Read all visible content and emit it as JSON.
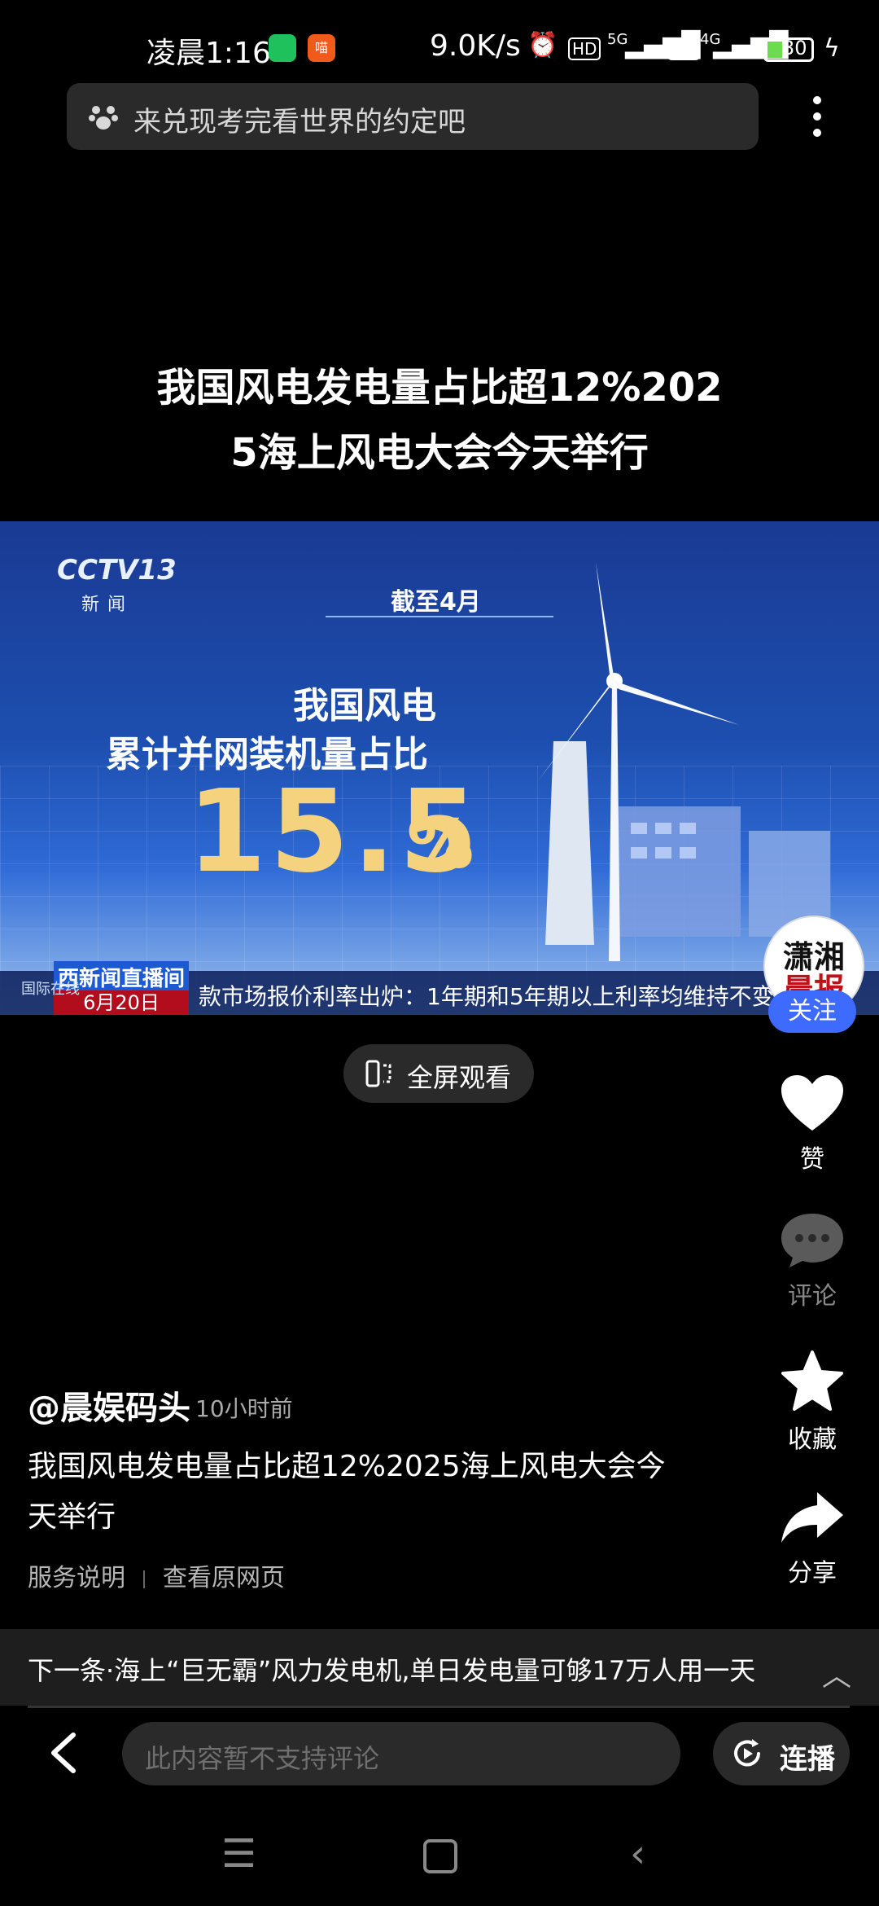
{
  "status_bar": {
    "time": "凌晨1:16",
    "net_speed": "9.0K/s",
    "signal1_label": "5G",
    "signal2_label": "4G",
    "hd_label": "HD",
    "battery": "30",
    "notification_badge": "喵",
    "wechat_icon": "wechat-icon",
    "alarm_icon": "alarm-icon"
  },
  "search": {
    "placeholder": "来兑现考完看世界的约定吧",
    "icon": "paw-icon"
  },
  "headline": {
    "line1": "我国风电发电量占比超12%202",
    "line2": "5海上风电大会今天举行"
  },
  "video": {
    "channel": "CCTV13",
    "channel_sub": "新闻",
    "caption": "截至4月",
    "text_line1": "我国风电",
    "text_line2": "累计并网装机量占比",
    "big_number": "15.5",
    "percent_sign": "%",
    "news_label": "西新闻直播间",
    "tiny_label": "国际在线",
    "date": "6月20日 11:01",
    "ticker": "款市场报价利率出炉：1年期和5年期以上利率均维持不变"
  },
  "avatar": {
    "line1": "潇湘",
    "line2": "晨报"
  },
  "follow_label": "关注",
  "fullscreen_label": "全屏观看",
  "actions": {
    "like": "赞",
    "comment": "评论",
    "favorite": "收藏",
    "share": "分享"
  },
  "post": {
    "author": "@晨娱码头",
    "age": "10小时前",
    "description": "我国风电发电量占比超12%2025海上风电大会今天举行",
    "link1": "服务说明",
    "link2": "查看原网页"
  },
  "next": {
    "text": "下一条·海上“巨无霸”风力发电机,单日发电量可够17万人用一天"
  },
  "bottom": {
    "comment_placeholder": "此内容暂不支持评论",
    "autoplay_label": "连播"
  },
  "colors": {
    "accent_follow": "#3d6bff",
    "battery_level": "#6bdc4e",
    "number_gold": "#f4d27e"
  }
}
